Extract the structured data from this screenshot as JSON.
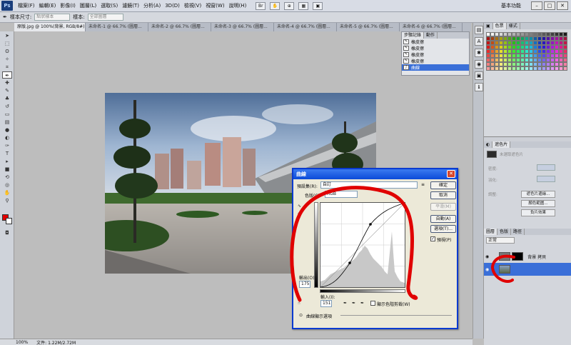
{
  "menubar": {
    "logo": "Ps",
    "items": [
      "檔案(F)",
      "編輯(E)",
      "影像(I)",
      "圖層(L)",
      "選取(S)",
      "濾鏡(T)",
      "分析(A)",
      "3D(D)",
      "檢視(V)",
      "視窗(W)",
      "說明(H)"
    ],
    "workspace": "基本功能"
  },
  "options": {
    "sample_label": "樣本尺寸:",
    "sample_value": "點狀樣本",
    "sample_target_label": "樣本:",
    "sample_target_value": "全部圖層"
  },
  "tabs": [
    {
      "label": "原版.jpg @ 100%(背景, RGB/8#) *"
    },
    {
      "label": "未命名-1 @ 66.7% (圖層..."
    },
    {
      "label": "未命名-2 @ 66.7% (圖層..."
    },
    {
      "label": "未命名-3 @ 66.7% (圖層..."
    },
    {
      "label": "未命名-4 @ 66.7% (圖層..."
    },
    {
      "label": "未命名-5 @ 66.7% (圖層..."
    },
    {
      "label": "未命名-6 @ 66.7% (圖層..."
    }
  ],
  "history": {
    "tabs": [
      "步驟記錄",
      "動作"
    ],
    "items": [
      {
        "label": "橡皮擦"
      },
      {
        "label": "橡皮擦"
      },
      {
        "label": "橡皮擦"
      },
      {
        "label": "橡皮擦"
      },
      {
        "label": "曲線"
      }
    ]
  },
  "status": {
    "zoom": "100%",
    "doc_info": "文件: 1.22M/2.72M"
  },
  "swatches_panel": {
    "tabs": [
      "色票",
      "樣式"
    ]
  },
  "adjustments": {
    "title": "遮色片",
    "hint": "未選取遮色片",
    "density_label": "密度:",
    "feather_label": "羽化:",
    "refine_label": "調整:",
    "btn_edge": "遮色片邊緣...",
    "btn_color_range": "顏色範圍...",
    "btn_invert": "負片效果"
  },
  "layers": {
    "tabs": [
      "圖層",
      "色版",
      "路徑"
    ],
    "blend_mode": "正常",
    "items": [
      {
        "name": "背景 拷貝",
        "selected": false
      },
      {
        "name": "",
        "selected": true
      }
    ]
  },
  "curves": {
    "title": "曲線",
    "preset_label": "預設集(R):",
    "preset_value": "自訂",
    "channel_label": "色版(C):",
    "channel_value": "RGB",
    "output_label": "輸出(O):",
    "output_value": "175",
    "input_label": "輸入(I):",
    "input_value": "151",
    "btn_ok": "確定",
    "btn_cancel": "取消",
    "btn_smooth": "平滑(M)",
    "btn_auto": "自動(A)",
    "btn_options": "選項(T)...",
    "preview_label": "預視(P)",
    "show_clipping": "顯示色階剪裁(W)",
    "display_options": "曲線顯示選項"
  }
}
